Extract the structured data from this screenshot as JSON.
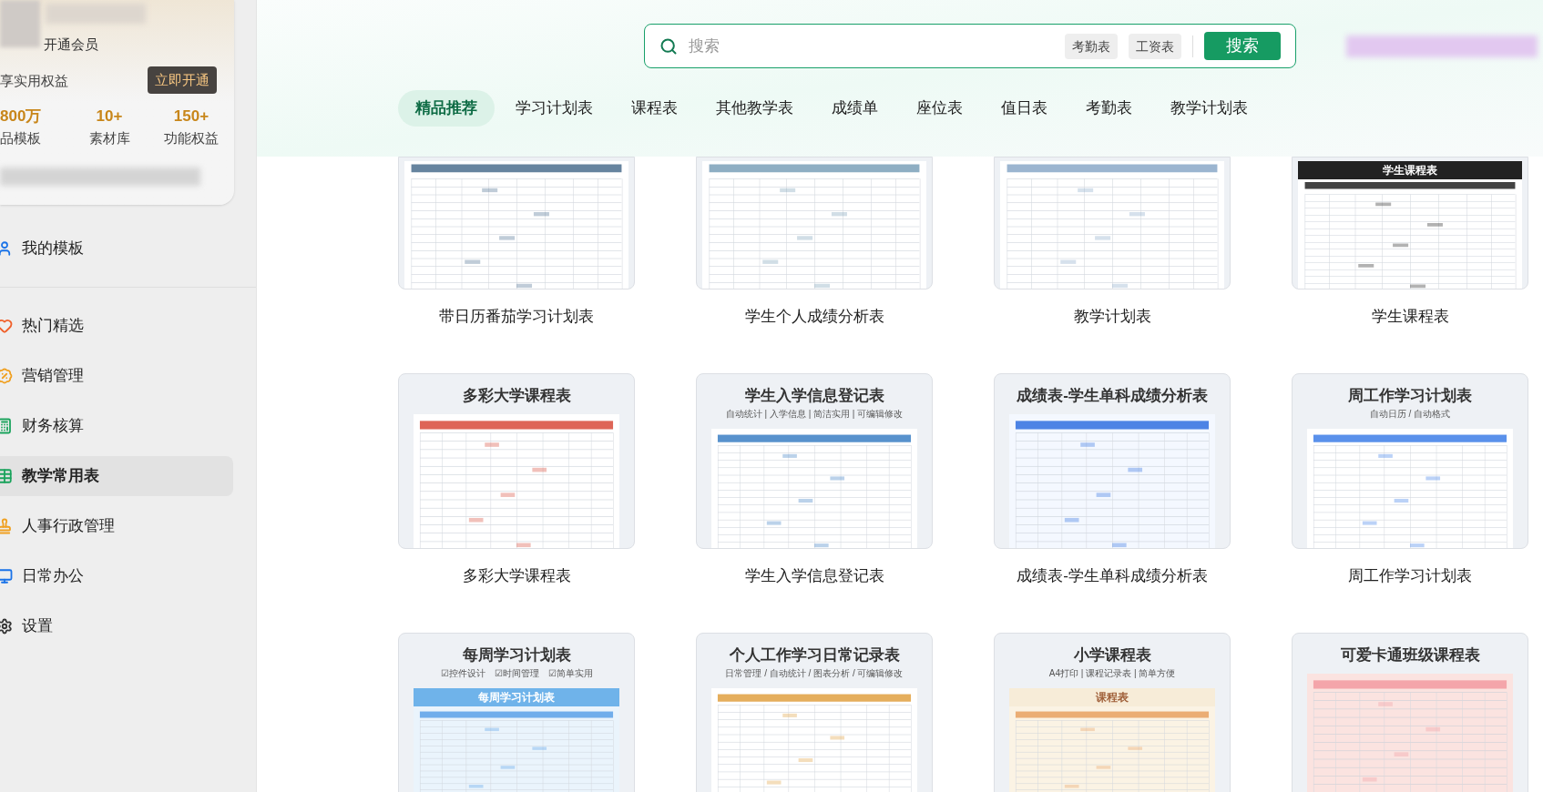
{
  "sidebar": {
    "member_card": {
      "title": "开通会员",
      "promo": "享实用权益",
      "cta": "立即开通",
      "stats": [
        {
          "value": "800万",
          "label": "品模板"
        },
        {
          "value": "10+",
          "label": "素材库"
        },
        {
          "value": "150+",
          "label": "功能权益"
        }
      ]
    },
    "sections": [
      {
        "items": [
          {
            "label": "我的模板",
            "selected": false
          }
        ]
      },
      {
        "items": [
          {
            "label": "热门精选",
            "selected": false
          },
          {
            "label": "营销管理",
            "selected": false
          },
          {
            "label": "财务核算",
            "selected": false
          },
          {
            "label": "教学常用表",
            "selected": true
          },
          {
            "label": "人事行政管理",
            "selected": false
          },
          {
            "label": "日常办公",
            "selected": false
          },
          {
            "label": "设置",
            "selected": false
          }
        ]
      }
    ]
  },
  "search": {
    "placeholder": "搜索",
    "suggestions": [
      "考勤表",
      "工资表"
    ],
    "button": "搜索"
  },
  "tabs": [
    {
      "label": "精品推荐",
      "selected": true
    },
    {
      "label": "学习计划表",
      "selected": false
    },
    {
      "label": "课程表",
      "selected": false
    },
    {
      "label": "其他教学表",
      "selected": false
    },
    {
      "label": "成绩单",
      "selected": false
    },
    {
      "label": "座位表",
      "selected": false
    },
    {
      "label": "值日表",
      "selected": false
    },
    {
      "label": "考勤表",
      "selected": false
    },
    {
      "label": "教学计划表",
      "selected": false
    }
  ],
  "rows": [
    {
      "cards": [
        {
          "title": "带日历番茄学习计划表"
        },
        {
          "title": "学生个人成绩分析表"
        },
        {
          "title": "教学计划表"
        },
        {
          "title": "学生课程表",
          "thumb": {
            "inner_title": "学生课程表"
          }
        }
      ]
    },
    {
      "cards": [
        {
          "title": "多彩大学课程表",
          "thumb": {
            "heading": "多彩大学课程表"
          }
        },
        {
          "title": "学生入学信息登记表",
          "thumb": {
            "heading": "学生入学信息登记表",
            "subtitle": "自动统计 | 入学信息 | 简洁实用 | 可编辑修改"
          }
        },
        {
          "title": "成绩表-学生单科成绩分析表",
          "thumb": {
            "heading": "成绩表-学生单科成绩分析表"
          }
        },
        {
          "title": "周工作学习计划表",
          "thumb": {
            "heading": "周工作学习计划表",
            "subtitle": "自动日历 / 自动格式"
          }
        }
      ]
    },
    {
      "cards": [
        {
          "thumb": {
            "heading": "每周学习计划表",
            "subtitle": "☑控件设计　☑时间管理　☑简单实用",
            "inner_title": "每周学习计划表"
          }
        },
        {
          "thumb": {
            "heading": "个人工作学习日常记录表",
            "subtitle": "日常管理 / 自动统计 / 图表分析 / 可编辑修改"
          }
        },
        {
          "thumb": {
            "heading": "小学课程表",
            "subtitle": "A4打印 | 课程记录表 | 简单方便",
            "inner_title": "课程表"
          }
        },
        {
          "thumb": {
            "heading": "可爱卡通班级课程表"
          }
        }
      ]
    }
  ]
}
